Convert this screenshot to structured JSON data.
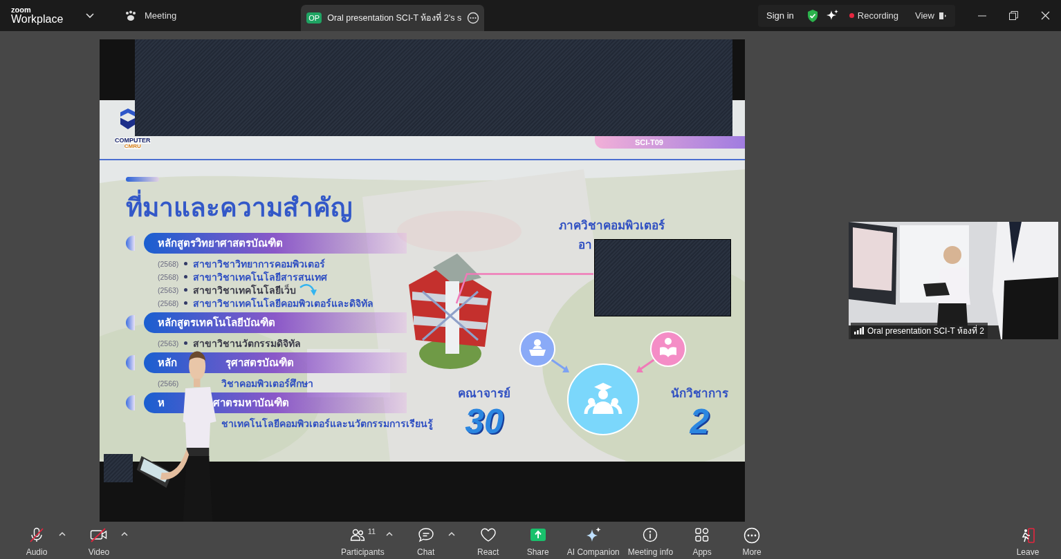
{
  "app": {
    "brand_top": "zoom",
    "brand": "Workplace",
    "menu": "Meeting"
  },
  "tab": {
    "badge": "OP",
    "title": "Oral presentation SCI-T ห้องที่ 2's s"
  },
  "header_right": {
    "sign_in": "Sign in",
    "recording": "Recording",
    "view": "View"
  },
  "slide": {
    "logo": [
      "COMPUTER",
      "CMRU"
    ],
    "badge": "SCI-T09",
    "title": "ที่มาและความสำคัญ",
    "sections": [
      {
        "parts": [
          "หลักสูตรวิทยาศาสตรบัณฑิต"
        ],
        "items": [
          {
            "year": "(2568)",
            "text": "สาขาวิชาวิทยาการคอมพิวเตอร์"
          },
          {
            "year": "(2568)",
            "text": "สาขาวิชาเทคโนโลยีสารสนเทศ"
          },
          {
            "year": "(2563)",
            "text": "สาขาวิชาเทคโนโลยีเว็บ"
          },
          {
            "year": "(2568)",
            "text": "สาขาวิชาเทคโนโลยีคอมพิวเตอร์และดิจิทัล"
          }
        ]
      },
      {
        "parts": [
          "หลักสูตรเทคโนโลยีบัณฑิต"
        ],
        "items": [
          {
            "year": "(2563)",
            "text": "สาขาวิชานวัตกรรมดิจิทัล"
          }
        ]
      },
      {
        "parts": [
          "หลัก",
          "รุศาสตรบัณฑิต"
        ],
        "items": [
          {
            "year": "(2566)",
            "text": "วิชาคอมพิวเตอร์ศึกษา",
            "covered": true
          }
        ]
      },
      {
        "parts": [
          "ห",
          "ศาตรมหาบัณฑิต"
        ],
        "items": [
          {
            "text": "ชาเทคโนโลยีคอมพิวเตอร์และนวัตกรรมการเรียนรู้",
            "covered": true
          }
        ]
      }
    ],
    "department": "ภาควิชาคอมพิวเตอร์",
    "building": "อา",
    "stats": [
      {
        "label": "คณาจารย์",
        "value": "30"
      },
      {
        "label": "นักวิชาการ",
        "value": "2"
      }
    ]
  },
  "video_tile": {
    "name": "Oral presentation SCI-T ห้องที่ 2"
  },
  "toolbar": [
    {
      "kind": "audio",
      "label": "Audio",
      "crossed": true,
      "caret": true
    },
    {
      "kind": "video",
      "label": "Video",
      "crossed": true,
      "caret": true
    },
    {
      "kind": "participants",
      "label": "Participants",
      "count": "11",
      "caret": true
    },
    {
      "kind": "chat",
      "label": "Chat",
      "caret": true
    },
    {
      "kind": "react",
      "label": "React"
    },
    {
      "kind": "share",
      "label": "Share"
    },
    {
      "kind": "ai",
      "label": "AI Companion"
    },
    {
      "kind": "info",
      "label": "Meeting info"
    },
    {
      "kind": "apps",
      "label": "Apps"
    },
    {
      "kind": "more",
      "label": "More"
    },
    {
      "kind": "leave",
      "label": "Leave"
    }
  ]
}
